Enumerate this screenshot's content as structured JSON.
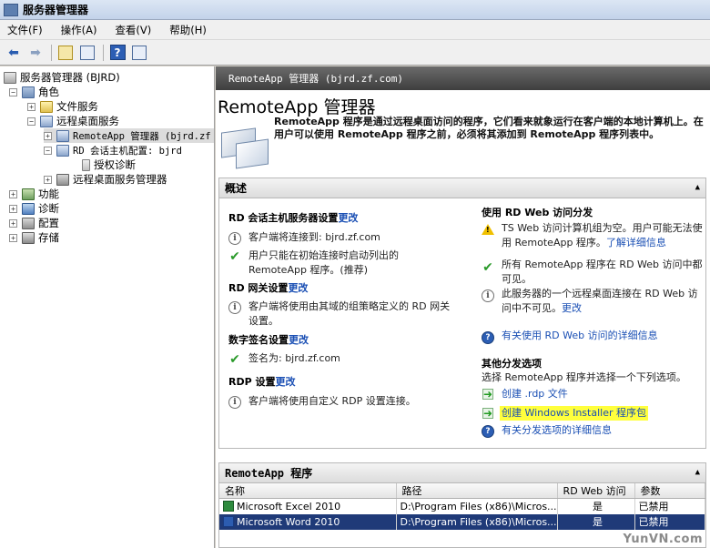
{
  "window": {
    "title": "服务器管理器"
  },
  "menu": [
    "文件(F)",
    "操作(A)",
    "查看(V)",
    "帮助(H)"
  ],
  "tree": {
    "root": "服务器管理器 (BJRD)",
    "roles": "角色",
    "file_services": "文件服务",
    "rds": "远程桌面服务",
    "remoteapp": "RemoteApp 管理器 (bjrd.zf",
    "rd_session": "RD 会话主机配置: bjrd",
    "license_diag": "授权诊断",
    "rds_manager": "远程桌面服务管理器",
    "features": "功能",
    "diagnostics": "诊断",
    "configuration": "配置",
    "storage": "存储"
  },
  "header": {
    "bar_title": "RemoteApp 管理器 (bjrd.zf.com)"
  },
  "intro": {
    "title": "RemoteApp 管理器",
    "description": "RemoteApp 程序是通过远程桌面访问的程序，它们看来就象运行在客户端的本地计算机上。在用户可以使用 RemoteApp 程序之前，必须将其添加到 RemoteApp 程序列表中。"
  },
  "overview": {
    "title": "概述",
    "left": {
      "rdsh_heading": "RD 会话主机服务器设置",
      "rdsh_change": "更改",
      "rdsh_item1": "客户端将连接到: bjrd.zf.com",
      "rdsh_item2": "用户只能在初始连接时启动列出的 RemoteApp 程序。(推荐)",
      "gw_heading": "RD 网关设置",
      "gw_change": "更改",
      "gw_item": "客户端将使用由其域的组策略定义的 RD 网关设置。",
      "sig_heading": "数字签名设置",
      "sig_change": "更改",
      "sig_item": "签名为: bjrd.zf.com",
      "rdp_heading": "RDP 设置",
      "rdp_change": "更改",
      "rdp_item": "客户端将使用自定义 RDP 设置连接。"
    },
    "right": {
      "web_heading": "使用 RD Web 访问分发",
      "web_item1": "TS Web 访问计算机组为空。用户可能无法使用 RemoteApp 程序。",
      "web_item1_link": "了解详细信息",
      "web_item2": "所有 RemoteApp 程序在 RD Web 访问中都可见。",
      "web_item3": "此服务器的一个远程桌面连接在 RD Web 访问中不可见。",
      "web_item3_link": "更改",
      "web_more": "有关使用 RD Web 访问的详细信息",
      "other_heading": "其他分发选项",
      "other_desc": "选择 RemoteApp 程序并选择一个下列选项。",
      "create_rdp": "创建 .rdp 文件",
      "create_msi": "创建 Windows Installer 程序包",
      "other_more": "有关分发选项的详细信息"
    }
  },
  "programs": {
    "title": "RemoteApp 程序",
    "columns": [
      "名称",
      "路径",
      "RD Web 访问",
      "参数"
    ],
    "rows": [
      {
        "name": "Microsoft Excel 2010",
        "path": "D:\\Program Files (x86)\\Micros...",
        "web": "是",
        "args": "已禁用"
      },
      {
        "name": "Microsoft Word 2010",
        "path": "D:\\Program Files (x86)\\Micros...",
        "web": "是",
        "args": "已禁用"
      }
    ]
  },
  "watermark": "YunVN.com"
}
